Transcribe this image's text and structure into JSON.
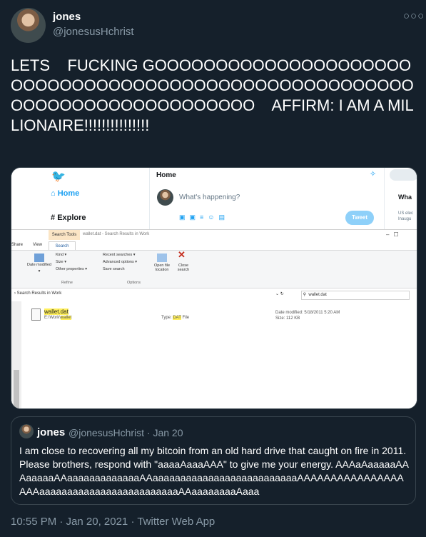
{
  "tweet": {
    "name": "jones",
    "handle": "@jonesusHchrist",
    "more_icon": "more-icon",
    "text": "LETS    FUCKING GOOOOOOOOOOOOOOOOOOOOOOOOOOOOOOOOOOOOOOOOOOOOOOOOOOOOOOOOOOOOOOOOOOOOOOOOOO    AFFIRM: I AM A MILLIONAIRE!!!!!!!!!!!!!!!",
    "footer": "10:55 PM · Jan 20, 2021 · Twitter Web App"
  },
  "media": {
    "twitter": {
      "home_title": "Home",
      "nav_home": "Home",
      "nav_explore": "Explore",
      "composer_placeholder": "What's happening?",
      "tweet_button": "Tweet",
      "right_heading": "Wha",
      "trend_lines": "US elec\nInaugu"
    },
    "explorer": {
      "search_tools_tab": "Search Tools",
      "title": "wallet.dat - Search Results in Work",
      "tabs": [
        "Share",
        "View",
        "Search"
      ],
      "ribbon": {
        "kind": "Kind ▾",
        "size": "Size ▾",
        "date_modified": "Date modified ▾",
        "other_properties": "Other properties ▾",
        "recent_searches": "Recent searches ▾",
        "advanced_options": "Advanced options ▾",
        "save_search": "Save search",
        "open_file_location": "Open file location",
        "close_search": "Close search",
        "group_refine": "Refine",
        "group_options": "Options"
      },
      "address": "Search Results in Work",
      "search_value": "wallet.dat",
      "file": {
        "name": "wallet.dat",
        "path_prefix": "E:\\Work\\",
        "path_hl": "wallet",
        "type_label": "Type: ",
        "type_hl": "DAT",
        "type_suffix": " File",
        "date_modified": "Date modified: 5/18/2011 5:20 AM",
        "size": "Size: 112 KB"
      }
    }
  },
  "quote": {
    "name": "jones",
    "meta": "@jonesusHchrist · Jan 20",
    "text": "I am close to recovering all my bitcoin from an old hard drive that caught on fire in 2011. Please brothers, respond with \"aaaaAaaaAAA\" to give me your energy. AAAaAaaaaaAAAaaaaaAAaaaaaaaaaaaaaAAaaaaaaaaaaaaaaaaaaaaaaaaaaAAAAAAAAAAAAAAAAAAAaaaaaaaaaaaaaaaaaaaaaaaaaAAaaaaaaaaAaaa"
  }
}
